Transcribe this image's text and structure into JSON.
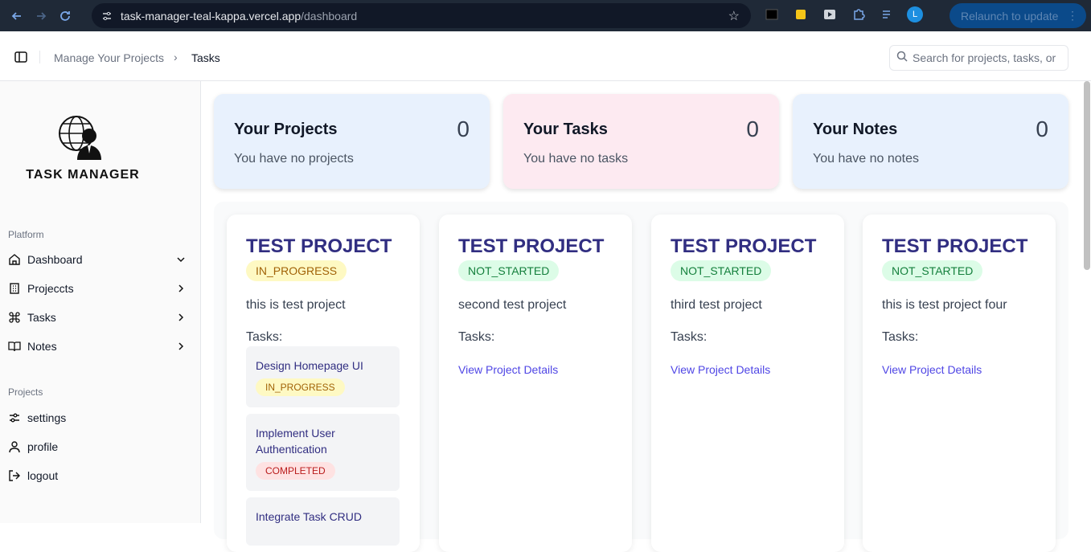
{
  "browser": {
    "url_host": "task-manager-teal-kappa.vercel.app",
    "url_path": "/dashboard",
    "relaunch_label": "Relaunch to update",
    "profile_initial": "L"
  },
  "header": {
    "breadcrumb_parent": "Manage Your Projects",
    "breadcrumb_current": "Tasks",
    "search_placeholder": "Search for projects, tasks, or"
  },
  "sidebar": {
    "logo_text": "TASK MANAGER",
    "platform_label": "Platform",
    "platform_items": [
      {
        "label": "Dashboard",
        "icon": "home-icon"
      },
      {
        "label": "Projeccts",
        "icon": "building-icon"
      },
      {
        "label": "Tasks",
        "icon": "command-icon"
      },
      {
        "label": "Notes",
        "icon": "book-icon"
      }
    ],
    "projects_label": "Projects",
    "project_items": [
      {
        "label": "settings",
        "icon": "sliders-icon"
      },
      {
        "label": "profile",
        "icon": "user-icon"
      },
      {
        "label": "logout",
        "icon": "logout-icon"
      }
    ]
  },
  "stats": [
    {
      "title": "Your Projects",
      "count": "0",
      "sub": "You have no projects",
      "color": "#e8f1fd"
    },
    {
      "title": "Your Tasks",
      "count": "0",
      "sub": "You have no tasks",
      "color": "#fdeaf1"
    },
    {
      "title": "Your Notes",
      "count": "0",
      "sub": "You have no notes",
      "color": "#e8f1fd"
    }
  ],
  "projects": [
    {
      "title": "TEST PROJECT",
      "status": "IN_PROGRESS",
      "description": "this is test project",
      "tasks_label": "Tasks:",
      "tasks": [
        {
          "name": "Design Homepage UI",
          "status": "IN_PROGRESS"
        },
        {
          "name": "Implement User Authentication",
          "status": "COMPLETED"
        },
        {
          "name": "Integrate Task CRUD",
          "status": ""
        }
      ]
    },
    {
      "title": "TEST PROJECT",
      "status": "NOT_STARTED",
      "description": "second test project",
      "tasks_label": "Tasks:",
      "link": "View Project Details"
    },
    {
      "title": "TEST PROJECT",
      "status": "NOT_STARTED",
      "description": "third test project",
      "tasks_label": "Tasks:",
      "link": "View Project Details"
    },
    {
      "title": "TEST PROJECT",
      "status": "NOT_STARTED",
      "description": "this is test project four",
      "tasks_label": "Tasks:",
      "link": "View Project Details"
    }
  ]
}
